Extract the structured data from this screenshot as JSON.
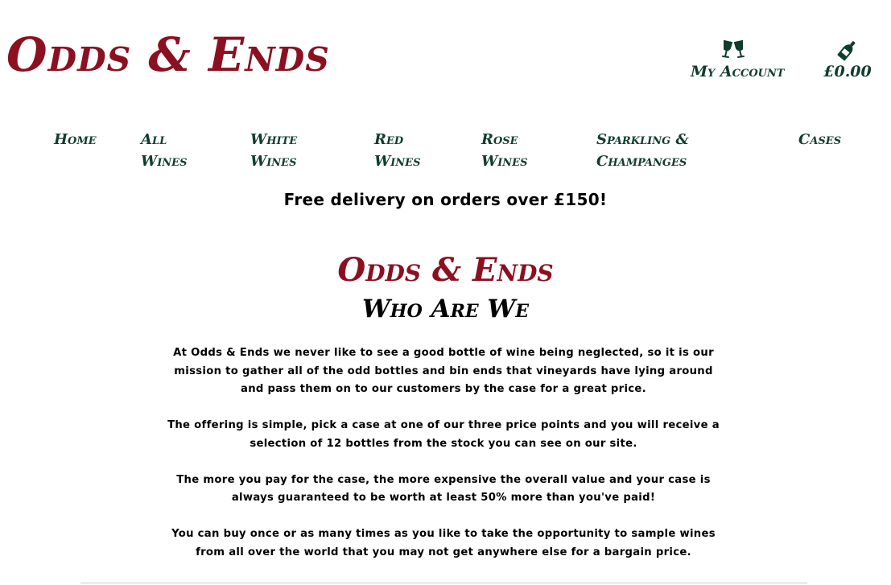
{
  "header": {
    "brand": "Odds & Ends",
    "account_label": "My Account",
    "account_icon": "wine-glasses-icon",
    "bag_total": "£0.00",
    "bag_icon": "wine-bottle-icon"
  },
  "nav": {
    "items": [
      {
        "lines": [
          "Home"
        ]
      },
      {
        "lines": [
          "All",
          "Wines"
        ]
      },
      {
        "lines": [
          "White",
          "Wines"
        ]
      },
      {
        "lines": [
          "Red",
          "Wines"
        ]
      },
      {
        "lines": [
          "Rose",
          "Wines"
        ]
      },
      {
        "lines": [
          "Sparkling &",
          "Champanges"
        ]
      },
      {
        "lines": [
          "Cases"
        ]
      }
    ]
  },
  "promo": "Free delivery on orders over £150!",
  "about": {
    "brand": "Odds & Ends",
    "title": "Who Are We",
    "paragraphs": [
      "At Odds & Ends we never like to see a good bottle of wine being neglected, so it is our mission to gather all of the odd bottles and bin ends that vineyards have lying around and pass them on to our customers by the case for a great price.",
      "The offering is simple, pick a case at one of our three price points and you will receive a selection of 12 bottles from the stock you can see on our site.",
      "The more you pay for the case, the more expensive the overall value and your case is always guaranteed to be worth at least 50% more than you've paid!",
      "You can buy once or as many times as you like to take the opportunity to sample wines from all over the world that you may not get anywhere else for a bargain price."
    ]
  },
  "colors": {
    "brand": "#8b1020",
    "nav": "#0f3d2e",
    "text": "#000000"
  }
}
